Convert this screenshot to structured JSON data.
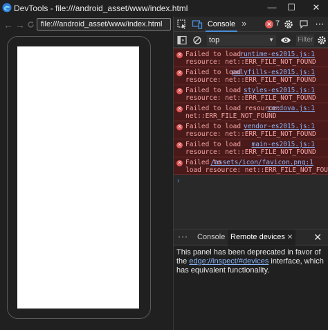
{
  "window": {
    "title": "DevTools - file:///android_asset/www/index.html",
    "minimize_glyph": "—",
    "maximize_glyph": "☐",
    "close_glyph": "✕"
  },
  "browser": {
    "back_glyph": "←",
    "forward_glyph": "→",
    "address": "file:///android_asset/www/index.html"
  },
  "devtools": {
    "tabs": {
      "console_label": "Console",
      "more_glyph": "»"
    },
    "error_badge": {
      "glyph": "✕",
      "count": "7"
    },
    "toolbar": {
      "context": "top",
      "filter_placeholder": "Filter"
    },
    "messages": [
      {
        "l1": "Failed to load",
        "l2": "resource: net::ERR_FILE_NOT_FOUND",
        "src": "runtime-es2015.js:1"
      },
      {
        "l1": "Failed to load",
        "l2": "resource: net::ERR_FILE_NOT_FOUND",
        "src": "polyfills-es2015.js:1"
      },
      {
        "l1": "Failed to load",
        "l2": "resource: net::ERR_FILE_NOT_FOUND",
        "src": "styles-es2015.js:1"
      },
      {
        "l1": "Failed to load resource:",
        "l2": "net::ERR_FILE_NOT_FOUND",
        "src": "cordova.js:1"
      },
      {
        "l1": "Failed to load",
        "l2": "resource: net::ERR_FILE_NOT_FOUND",
        "src": "vendor-es2015.js:1"
      },
      {
        "l1": "Failed to load",
        "l2": "resource: net::ERR_FILE_NOT_FOUND",
        "src": "main-es2015.js:1"
      },
      {
        "l1": "Failed to",
        "l2": "load resource: net::ERR_FILE_NOT_FOUND",
        "src": "/assets/icon/favicon.png:1"
      }
    ],
    "prompt_glyph": "›",
    "drawer": {
      "more_glyph": "···",
      "tab_console": "Console",
      "tab_remote": "Remote devices",
      "tab_close_glyph": "✕",
      "close_glyph": "✕",
      "text_before": "This panel has been deprecated in favor of the ",
      "link_text": "edge://inspect/#devices",
      "text_after": " interface, which has equivalent functionality."
    }
  },
  "colors": {
    "accent": "#4a8eda",
    "error_bg": "#4a1a1a",
    "error_text": "#f6a3a3",
    "link": "#8ab4f8"
  }
}
